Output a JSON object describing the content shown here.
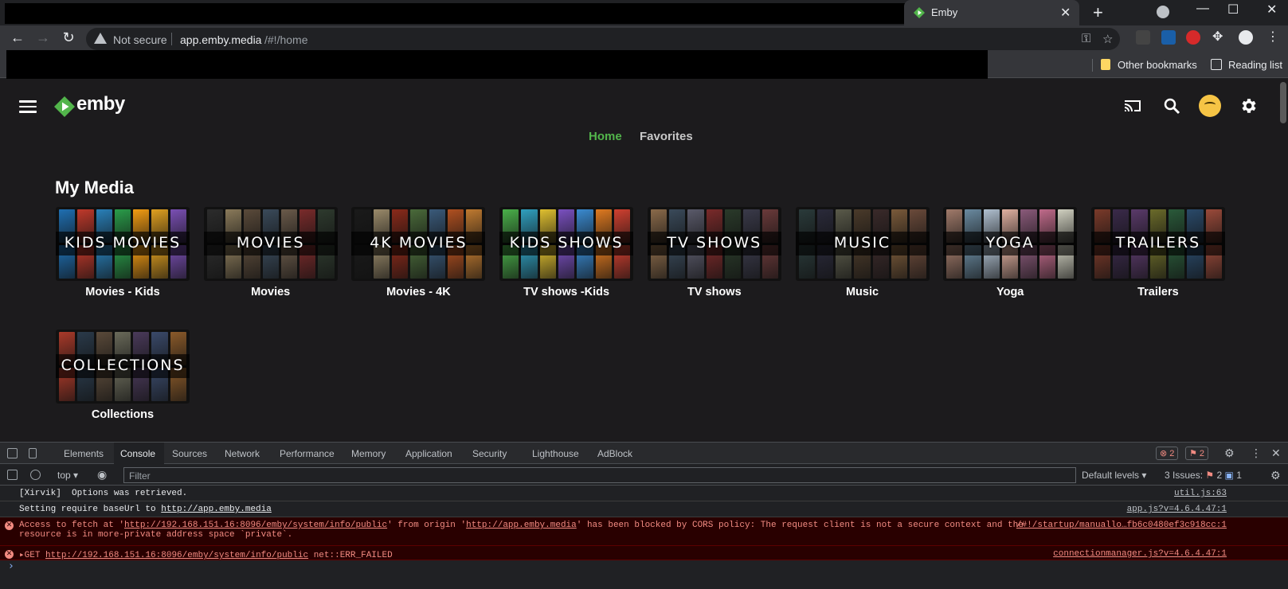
{
  "browser": {
    "tab_title": "Emby",
    "tab_close": "✕",
    "new_tab": "+",
    "not_secure": "Not secure",
    "url_host": "app.emby.media",
    "url_path": "/#!/home",
    "bookmarks": [
      {
        "label": "Other bookmarks",
        "icon": "folder-icon"
      },
      {
        "label": "Reading list",
        "icon": "reading-list-icon"
      }
    ]
  },
  "emby": {
    "brand": "emby",
    "accent": "#52b54b",
    "tabs": [
      {
        "label": "Home",
        "active": true
      },
      {
        "label": "Favorites",
        "active": false
      }
    ],
    "section_title": "My Media",
    "libraries": [
      {
        "name": "Movies - Kids",
        "art_text": "KIDS MOVIES",
        "palette": [
          "#1f6fb2",
          "#e0a020",
          "#2a9d4a",
          "#c0392b",
          "#7a4fb4",
          "#f39c12",
          "#2980b9"
        ]
      },
      {
        "name": "Movies",
        "art_text": "MOVIES",
        "palette": [
          "#5a4a3a",
          "#2c2c2c",
          "#7a2b2b",
          "#3a4a5a",
          "#8a7a5a",
          "#2e3a2e",
          "#6a5a4a"
        ]
      },
      {
        "name": "Movies - 4K",
        "art_text": "4K MOVIES",
        "palette": [
          "#3a5a7a",
          "#8a2a1a",
          "#1a1a1a",
          "#b05020",
          "#4a6a3a",
          "#9a8a6a",
          "#c07a30"
        ]
      },
      {
        "name": "TV shows -Kids",
        "art_text": "KIDS SHOWS",
        "palette": [
          "#d04030",
          "#3a8ad0",
          "#e0c030",
          "#4ab04a",
          "#e07a20",
          "#7a50c0",
          "#30a0c0"
        ]
      },
      {
        "name": "TV shows",
        "art_text": "TV SHOWS",
        "palette": [
          "#3a4a5a",
          "#6a3a3a",
          "#2a3a2a",
          "#5a5a6a",
          "#8a6a4a",
          "#3a3a4a",
          "#7a2a2a"
        ]
      },
      {
        "name": "Music",
        "art_text": "MUSIC",
        "palette": [
          "#4a3a2a",
          "#2a2a3a",
          "#6a4a3a",
          "#3a2a2a",
          "#5a5a4a",
          "#2a3a3a",
          "#7a5a3a"
        ]
      },
      {
        "name": "Yoga",
        "art_text": "YOGA",
        "palette": [
          "#c06a8a",
          "#e0b0a0",
          "#6a8aa0",
          "#d0d0c0",
          "#8a5a7a",
          "#b0c0d0",
          "#a07a6a"
        ]
      },
      {
        "name": "Trailers",
        "art_text": "TRAILERS",
        "palette": [
          "#7a3a2a",
          "#2a4a6a",
          "#6a6a2a",
          "#3a2a4a",
          "#9a4a3a",
          "#2a5a3a",
          "#5a3a6a"
        ]
      },
      {
        "name": "Collections",
        "art_text": "COLLECTIONS",
        "palette": [
          "#5a4a3a",
          "#aa3a2a",
          "#3a4a6a",
          "#6a6a5a",
          "#2a3a4a",
          "#8a5a2a",
          "#4a3a5a"
        ]
      }
    ]
  },
  "devtools": {
    "tabs": [
      "Elements",
      "Console",
      "Sources",
      "Network",
      "Performance",
      "Memory",
      "Application",
      "Security",
      "Lighthouse",
      "AdBlock"
    ],
    "active_tab": "Console",
    "error_count": "2",
    "warning_count": "2",
    "context": "top",
    "filter_placeholder": "Filter",
    "levels": "Default levels",
    "issues_label": "3 Issues:",
    "issues_errors": "2",
    "issues_info": "1",
    "logs": [
      {
        "type": "info",
        "message": "[Xirvik]  Options was retrieved.",
        "source": "util.js:63"
      },
      {
        "type": "info",
        "message": "Setting require baseUrl to ",
        "link": "http://app.emby.media",
        "source": "app.js?v=4.6.4.47:1"
      },
      {
        "type": "error",
        "p1": "Access to fetch at '",
        "l1": "http://192.168.151.16:8096/emby/system/info/public",
        "p2": "' from origin '",
        "l2": "http://app.emby.media",
        "p3": "' has been blocked by CORS policy: The request client is not a secure context and the",
        "line2": "resource is in more-private address space `private`.",
        "source": "/#!/startup/manuallo…fb6c0480ef3c918cc:1"
      },
      {
        "type": "error",
        "prefix": "▸GET ",
        "link": "http://192.168.151.16:8096/emby/system/info/public",
        "suffix": " net::ERR_FAILED",
        "source": "connectionmanager.js?v=4.6.4.47:1"
      }
    ],
    "prompt": "›"
  }
}
